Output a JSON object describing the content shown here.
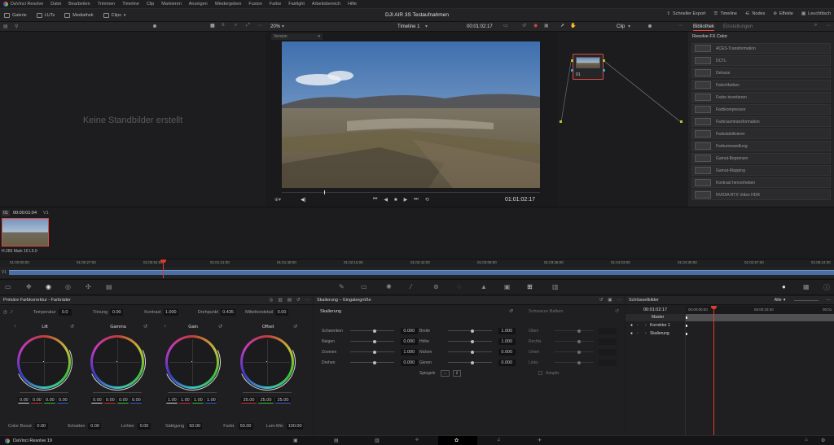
{
  "menubar": {
    "app_label": "DaVinci Resolve",
    "items": [
      "Datei",
      "Bearbeiten",
      "Trimmen",
      "Timeline",
      "Clip",
      "Markieren",
      "Anzeigen",
      "Wiedergeben",
      "Fusion",
      "Farbe",
      "Fairlight",
      "Arbeitsbereich",
      "Hilfe"
    ]
  },
  "toolbar": {
    "gallery": "Galerie",
    "luts": "LUTs",
    "media": "Mediathek",
    "clips": "Clips",
    "project_title": "DJI AIR 3S Testaufnahmen",
    "quick_export": "Schneller Export",
    "timeline": "Timeline",
    "nodes": "Nodes",
    "effects": "Effekte",
    "lightbox": "Leuchttisch"
  },
  "subbar": {
    "zoom": "20%",
    "timeline_name": "Timeline 1",
    "timecode": "00:01:02:17",
    "clip_label": "Clip",
    "library_tab": "Bibliothek",
    "settings_tab": "Einstellungen"
  },
  "gallery": {
    "empty_text": "Keine Standbilder erstellt"
  },
  "viewer": {
    "version_label": "Version",
    "timecode": "01:01:02:17"
  },
  "nodes": {
    "node_label": "01"
  },
  "library": {
    "header": "Resolve FX Color",
    "items": [
      "ACES-Transformation",
      "DCTL",
      "Dehaze",
      "Falschfarben",
      "Farbe invertieren",
      "Farbkompressor",
      "Farbraumtransformation",
      "Farbstabilisierer",
      "Farbumwandlung",
      "Gamut-Begrenzer",
      "Gamut-Mapping",
      "Kontrast hervorheben",
      "NVIDIA RTX Video HDR"
    ]
  },
  "clipstrip": {
    "clip_num": "01",
    "clip_tc": "00:00:01:04",
    "track": "V1",
    "codec": "H.265 Main 10 L5.0"
  },
  "ruler": {
    "marks": [
      "01:00:00:00",
      "01:00:27:00",
      "01:00:54:00",
      "01:01:21:00",
      "01:01:48:00",
      "01:02:15:00",
      "01:02:42:00",
      "01:03:09:00",
      "01:03:36:00",
      "01:04:03:00",
      "01:04:30:00",
      "01:04:57:00",
      "01:05:24:00"
    ],
    "track": "V1"
  },
  "primaries": {
    "title": "Primäre Farbkorrektur - Farbräder",
    "temperature_label": "Temperatur",
    "temperature": "0.0",
    "tint_label": "Tönung",
    "tint": "0.00",
    "contrast_label": "Kontrast",
    "contrast": "1.000",
    "pivot_label": "Drehpunkt",
    "pivot": "0.435",
    "middetail_label": "Mitteltondetail",
    "middetail": "0.00",
    "wheels": [
      {
        "name": "Lift",
        "values": [
          "0.00",
          "0.00",
          "0.00",
          "0.00"
        ]
      },
      {
        "name": "Gamma",
        "values": [
          "0.00",
          "0.00",
          "0.00",
          "0.00"
        ]
      },
      {
        "name": "Gain",
        "values": [
          "1.00",
          "1.00",
          "1.00",
          "1.00"
        ]
      },
      {
        "name": "Offset",
        "values": [
          "25.00",
          "25.00",
          "25.00"
        ]
      }
    ],
    "colorboost_label": "Color Boost",
    "colorboost": "0.00",
    "shadows_label": "Schatten",
    "shadows": "0.00",
    "highlights_label": "Lichter",
    "highlights": "0.00",
    "saturation_label": "Sättigung",
    "saturation": "50.00",
    "hue_label": "Farbt.",
    "hue": "50.00",
    "lummix_label": "Lum-Mix",
    "lummix": "100.00"
  },
  "sizing": {
    "title": "Skalierung – Eingabegröße",
    "section": "Skalierung",
    "black_bars": "Schwarze Balken",
    "left_params": [
      {
        "label": "Schwenken",
        "value": "0.000"
      },
      {
        "label": "Neigen",
        "value": "0.000"
      },
      {
        "label": "Zoomen",
        "value": "1.000"
      },
      {
        "label": "Drehen",
        "value": "0.000"
      }
    ],
    "right_params": [
      {
        "label": "Breite",
        "value": "1.000"
      },
      {
        "label": "Höhe",
        "value": "1.000"
      },
      {
        "label": "Nicken",
        "value": "0.000"
      },
      {
        "label": "Gieren",
        "value": "0.000"
      }
    ],
    "mirror_label": "Spiegeln",
    "bar_params": [
      "Oben",
      "Rechts",
      "Unten",
      "Links"
    ],
    "adaptive_label": "Adaptiv"
  },
  "keyframes": {
    "title": "Schlüsselbilder",
    "filter": "Alle",
    "timecode": "00:01:02:17",
    "tc1": "00:00:00:00",
    "tc2": "00:00:33:40",
    "tc3": "00:01",
    "tracks": [
      "Master",
      "Korrektor 1",
      "Skalierung"
    ]
  },
  "pagenav": {
    "app_label": "DaVinci Resolve 19"
  },
  "colors": {
    "accent": "#e04a3f",
    "playhead": "#e23a2a",
    "track": "#4a6fa5",
    "node_green": "#b6c42a"
  }
}
